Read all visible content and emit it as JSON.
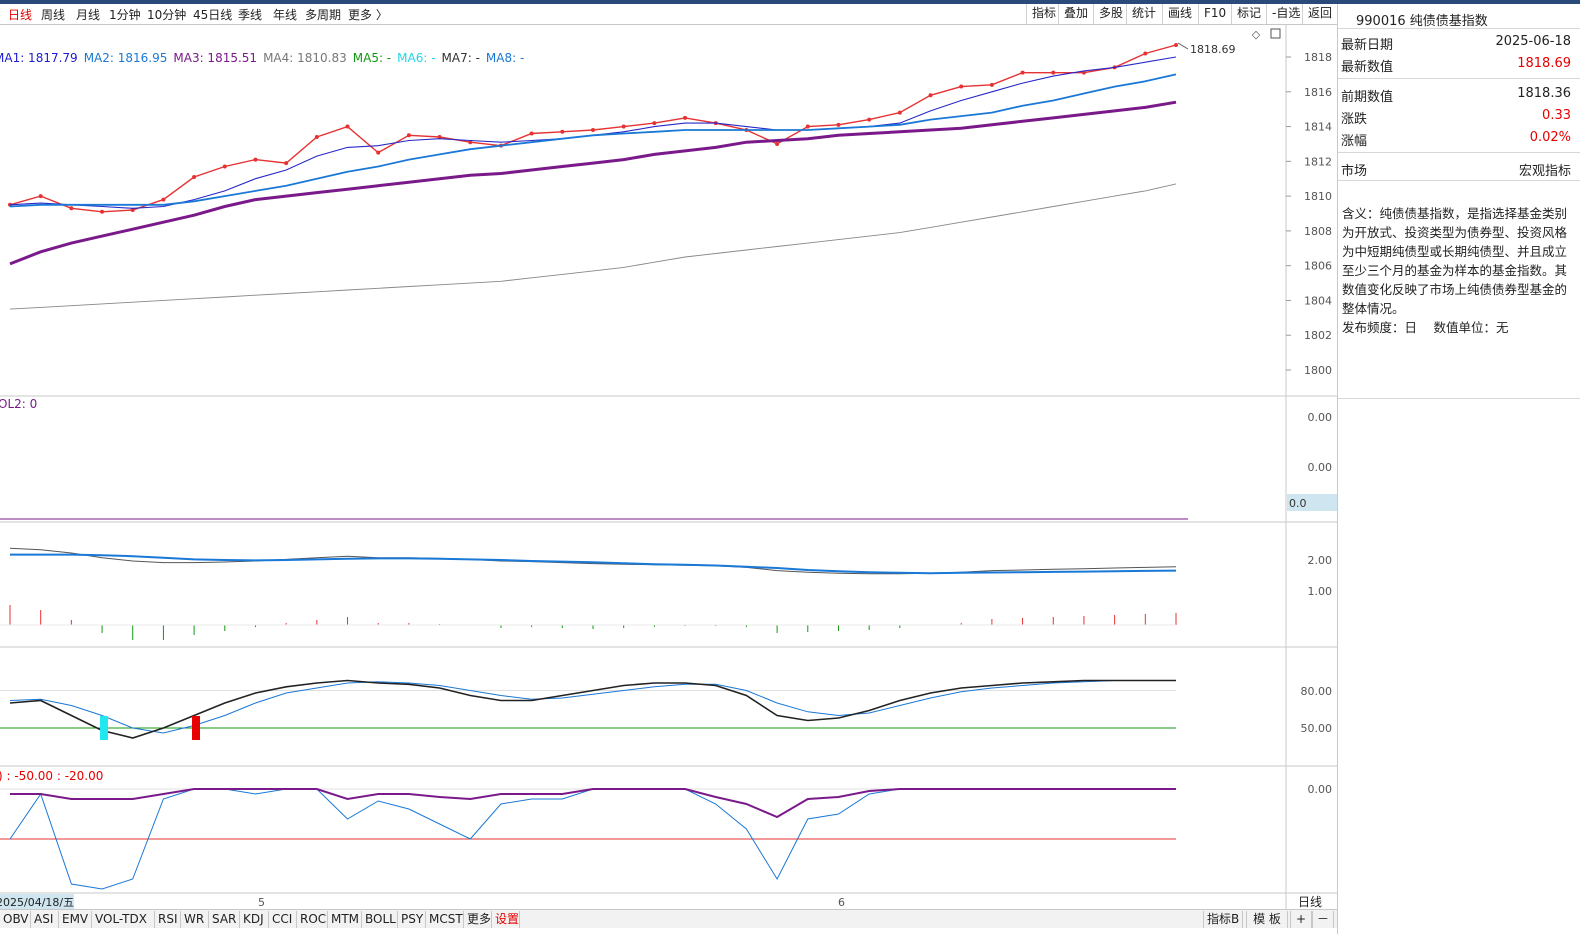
{
  "periods": [
    "日线",
    "周线",
    "月线",
    "1分钟",
    "10分钟",
    "45日线",
    "季线",
    "年线",
    "多周期",
    "更多 〉"
  ],
  "active_period": "日线",
  "toolbar": [
    "指标",
    "叠加",
    "多股",
    "统计",
    "画线",
    "F10",
    "标记",
    "-自选",
    "返回"
  ],
  "ma_legend": [
    {
      "label": "MA1: 1817.79",
      "color": "#1c1ccf"
    },
    {
      "label": "MA2: 1816.95",
      "color": "#1a78d6"
    },
    {
      "label": "MA3: 1815.51",
      "color": "#7a1a8a"
    },
    {
      "label": "MA4: 1810.83",
      "color": "#777777"
    },
    {
      "label": "MA5: -",
      "color": "#119911"
    },
    {
      "label": "MA6: -",
      "color": "#22d6e6"
    },
    {
      "label": "MA7: -",
      "color": "#333333"
    },
    {
      "label": "MA8: -",
      "color": "#1a78d6"
    }
  ],
  "last_price_label": "1818.69",
  "price_axis_ticks": [
    "1818",
    "1816",
    "1814",
    "1812",
    "1810",
    "1808",
    "1806",
    "1804",
    "1802",
    "1800"
  ],
  "vol_label": "OL2: 0",
  "vol_axis_ticks": [
    "0.00",
    "0.00"
  ],
  "vol_axis_box": "0.0",
  "macd_axis_ticks": [
    "2.00",
    "1.00"
  ],
  "kdj_axis_ticks": [
    "80.00",
    "50.00"
  ],
  "wr_label": ") : -50.00 : -20.00",
  "wr_axis_ticks": [
    "0.00"
  ],
  "date_label": "2025/04/18/五",
  "month_labels": [
    "5",
    "6"
  ],
  "period_indicator": "日线",
  "right_panel": {
    "title": "990016 纯债债基指数",
    "rows": [
      {
        "k": "最新日期",
        "v": "2025-06-18",
        "red": false
      },
      {
        "k": "最新数值",
        "v": "1818.69",
        "red": true
      },
      {
        "k": "前期数值",
        "v": "1818.36",
        "red": false
      },
      {
        "k": "涨跌",
        "v": "0.33",
        "red": true
      },
      {
        "k": "涨幅",
        "v": "0.02%",
        "red": true
      },
      {
        "k": "市场",
        "v": "宏观指标",
        "red": false
      }
    ],
    "description": "含义：纯债债基指数，是指选择基金类别为开放式、投资类型为债券型、投资风格为中短期纯债型或长期纯债型、并且成立至少三个月的基金为样本的基金指数。其数值变化反映了市场上纯债债券型基金的整体情况。",
    "freq": "发布频度：日　 数值单位：无"
  },
  "bottom_tabs": [
    "OBV",
    "ASI",
    "EMV",
    "VOL-TDX",
    "RSI",
    "WR",
    "SAR",
    "KDJ",
    "CCI",
    "ROC",
    "MTM",
    "BOLL",
    "PSY",
    "MCST",
    "更多",
    "设置"
  ],
  "bottom_right": [
    "指标B",
    "模 板",
    "+",
    "－"
  ],
  "chart_data": {
    "type": "line",
    "ylim": [
      1799,
      1819.5
    ],
    "series": [
      {
        "name": "MA1",
        "color": "#e63232",
        "values": [
          1809.5,
          1810,
          1809.3,
          1809.1,
          1809.2,
          1809.8,
          1811.1,
          1811.7,
          1812.1,
          1811.9,
          1813.4,
          1814,
          1812.5,
          1813.5,
          1813.4,
          1813.1,
          1812.9,
          1813.6,
          1813.7,
          1813.8,
          1814,
          1814.2,
          1814.5,
          1814.2,
          1813.8,
          1813,
          1814,
          1814.1,
          1814.4,
          1814.8,
          1815.8,
          1816.3,
          1816.4,
          1817.1,
          1817.1,
          1817.1,
          1817.4,
          1818.2,
          1818.69
        ]
      },
      {
        "name": "MA2",
        "color": "#2828c8",
        "values": [
          1809.5,
          1809.6,
          1809.5,
          1809.4,
          1809.3,
          1809.4,
          1809.8,
          1810.3,
          1811,
          1811.5,
          1812.3,
          1812.8,
          1812.9,
          1813.2,
          1813.3,
          1813.2,
          1813.1,
          1813.2,
          1813.3,
          1813.5,
          1813.7,
          1814,
          1814.2,
          1814.2,
          1814,
          1813.8,
          1813.8,
          1813.9,
          1814,
          1814.2,
          1814.9,
          1815.5,
          1816,
          1816.5,
          1816.9,
          1817.2,
          1817.4,
          1817.7,
          1818
        ]
      },
      {
        "name": "MA3",
        "color": "#1a78d6",
        "values": [
          1809.4,
          1809.5,
          1809.5,
          1809.5,
          1809.5,
          1809.5,
          1809.7,
          1810,
          1810.3,
          1810.6,
          1811,
          1811.4,
          1811.7,
          1812.1,
          1812.4,
          1812.7,
          1812.9,
          1813.1,
          1813.3,
          1813.5,
          1813.6,
          1813.7,
          1813.8,
          1813.8,
          1813.8,
          1813.8,
          1813.8,
          1813.9,
          1814,
          1814.1,
          1814.4,
          1814.6,
          1814.8,
          1815.2,
          1815.5,
          1815.9,
          1816.3,
          1816.6,
          1817
        ]
      },
      {
        "name": "MA4",
        "color": "#7a1a8a",
        "values": [
          1806.1,
          1806.8,
          1807.3,
          1807.7,
          1808.1,
          1808.5,
          1808.9,
          1809.4,
          1809.8,
          1810,
          1810.2,
          1810.4,
          1810.6,
          1810.8,
          1811,
          1811.2,
          1811.3,
          1811.5,
          1811.7,
          1811.9,
          1812.1,
          1812.4,
          1812.6,
          1812.8,
          1813.1,
          1813.2,
          1813.3,
          1813.5,
          1813.6,
          1813.7,
          1813.8,
          1813.9,
          1814.1,
          1814.3,
          1814.5,
          1814.7,
          1814.9,
          1815.1,
          1815.4
        ]
      },
      {
        "name": "MA5",
        "color": "#888888",
        "values": [
          1803.5,
          1803.6,
          1803.7,
          1803.8,
          1803.9,
          1804,
          1804.1,
          1804.2,
          1804.3,
          1804.4,
          1804.5,
          1804.6,
          1804.7,
          1804.8,
          1804.9,
          1805,
          1805.1,
          1805.3,
          1805.5,
          1805.7,
          1805.9,
          1806.2,
          1806.5,
          1806.7,
          1806.9,
          1807.1,
          1807.3,
          1807.5,
          1807.7,
          1807.9,
          1808.2,
          1808.5,
          1808.8,
          1809.1,
          1809.4,
          1809.7,
          1810,
          1810.3,
          1810.7
        ]
      }
    ]
  }
}
